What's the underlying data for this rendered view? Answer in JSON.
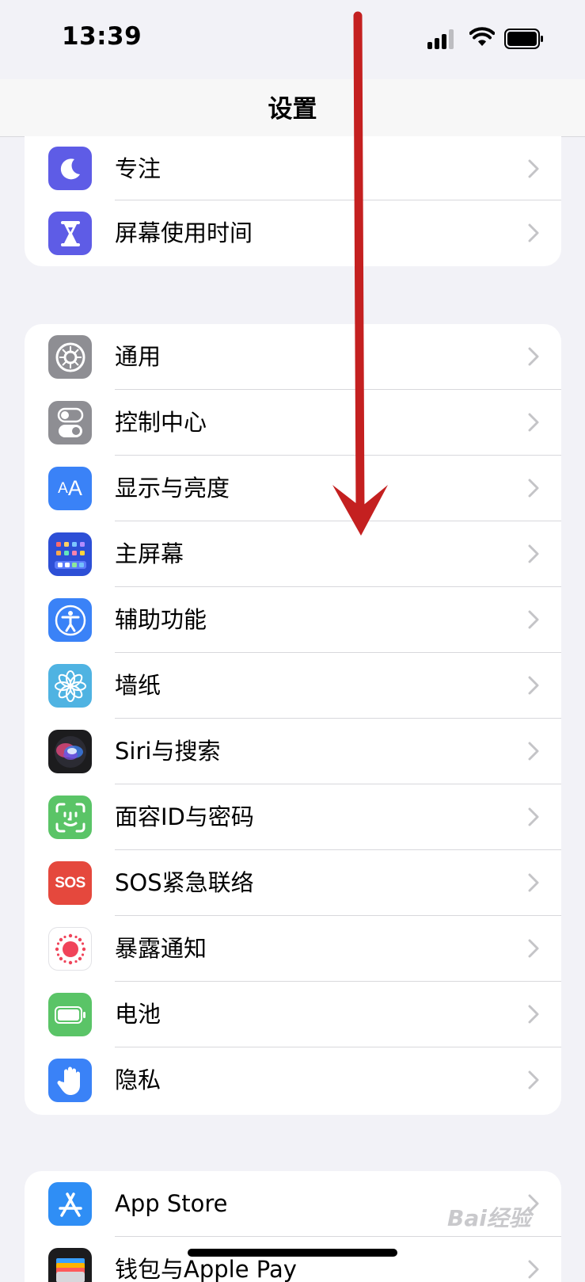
{
  "status_bar": {
    "time": "13:39"
  },
  "nav": {
    "title": "设置"
  },
  "groups": [
    {
      "rows": [
        {
          "label": "专注",
          "icon": "moon-icon",
          "color": "#5e5ce6"
        },
        {
          "label": "屏幕使用时间",
          "icon": "hourglass-icon",
          "color": "#5e5ce6"
        }
      ]
    },
    {
      "rows": [
        {
          "label": "通用",
          "icon": "gear-icon",
          "color": "#8e8e93"
        },
        {
          "label": "控制中心",
          "icon": "toggles-icon",
          "color": "#8e8e93"
        },
        {
          "label": "显示与亮度",
          "icon": "text-size-icon",
          "color": "#3a82f7"
        },
        {
          "label": "主屏幕",
          "icon": "home-grid-icon",
          "color": "#2d4fd6"
        },
        {
          "label": "辅助功能",
          "icon": "accessibility-icon",
          "color": "#3a82f7"
        },
        {
          "label": "墙纸",
          "icon": "flower-icon",
          "color": "#4fb3e2"
        },
        {
          "label": "Siri与搜索",
          "icon": "siri-icon",
          "color": "#1c1c1e"
        },
        {
          "label": "面容ID与密码",
          "icon": "face-id-icon",
          "color": "#5ac467"
        },
        {
          "label": "SOS紧急联络",
          "icon": "sos-icon",
          "color": "#e5483d"
        },
        {
          "label": "暴露通知",
          "icon": "exposure-icon",
          "color": "#ffffff"
        },
        {
          "label": "电池",
          "icon": "battery-icon",
          "color": "#5ac467"
        },
        {
          "label": "隐私",
          "icon": "hand-icon",
          "color": "#3a82f7"
        }
      ]
    },
    {
      "rows": [
        {
          "label": "App Store",
          "icon": "app-store-icon",
          "color": "#2f8ef5"
        },
        {
          "label": "钱包与Apple Pay",
          "icon": "wallet-icon",
          "color": "#1c1c1e"
        }
      ]
    }
  ],
  "watermark": "Bai经验",
  "colors": {
    "background": "#f2f2f7",
    "annotation_arrow": "#c42020"
  }
}
